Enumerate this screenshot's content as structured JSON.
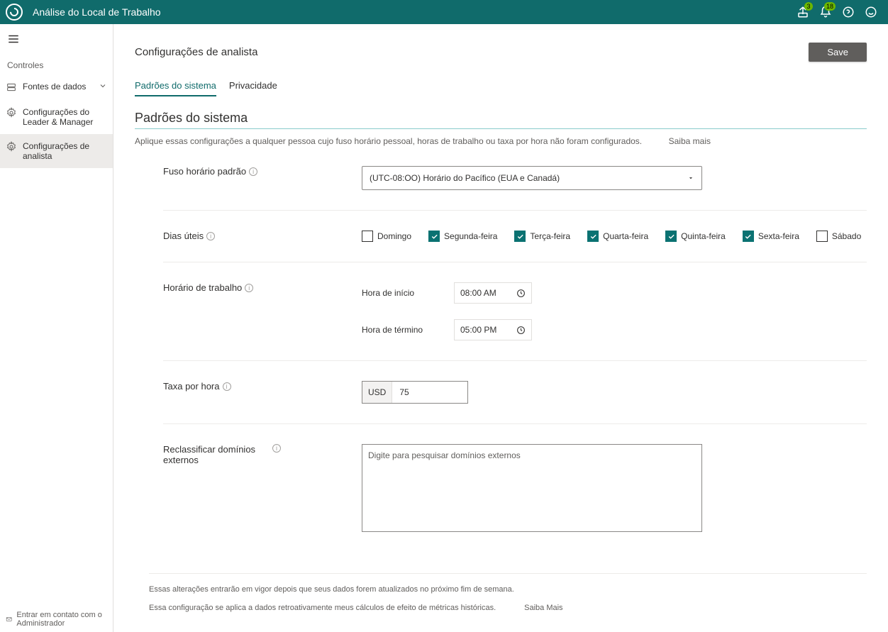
{
  "topbar": {
    "title": "Análise do Local de Trabalho",
    "share_badge": "3",
    "bell_badge": "18"
  },
  "sidebar": {
    "section_label": "Controles",
    "items": [
      {
        "label": "Fontes de dados",
        "has_chevron": true
      },
      {
        "label": "Configurações do Leader &amp; Manager"
      },
      {
        "label": "Configurações de analista",
        "active": true
      }
    ],
    "footer": "Entrar em contato com o Administrador"
  },
  "page": {
    "title": "Configurações de analista",
    "save": "Save",
    "tabs": [
      "Padrões do sistema",
      "Privacidade"
    ],
    "section_heading": "Padrões do sistema",
    "help_text": "Aplique essas configurações a qualquer pessoa cujo fuso horário pessoal, horas de trabalho ou taxa por hora não foram configurados.",
    "learn_more": "Saiba mais"
  },
  "tz": {
    "label": "Fuso horário padrão",
    "value": "(UTC-08:OO) Horário do Pacífico (EUA e Canadá)"
  },
  "days": {
    "label": "Dias úteis",
    "options": [
      {
        "label": "Domingo",
        "checked": false
      },
      {
        "label": "Segunda-feira",
        "checked": true
      },
      {
        "label": "Terça-feira",
        "checked": true
      },
      {
        "label": "Quarta-feira",
        "checked": true
      },
      {
        "label": "Quinta-feira",
        "checked": true
      },
      {
        "label": "Sexta-feira",
        "checked": true
      },
      {
        "label": "Sábado",
        "checked": false
      }
    ]
  },
  "hours": {
    "label": "Horário de trabalho",
    "start_label": "Hora de início",
    "start_value": "08:00  AM",
    "end_label": "Hora de término",
    "end_value": "05:00  PM"
  },
  "rate": {
    "label": "Taxa por hora",
    "currency": "USD",
    "value": "75"
  },
  "domains": {
    "label": "Reclassificar domínios externos",
    "placeholder": "Digite para pesquisar domínios externos"
  },
  "footer": {
    "note1": "Essas alterações entrarão em vigor depois que seus dados forem atualizados no próximo fim de semana.",
    "note2": "Essa configuração se aplica a dados retroativamente meus cálculos de efeito de métricas históricas.",
    "learn_more": "Saiba Mais"
  }
}
